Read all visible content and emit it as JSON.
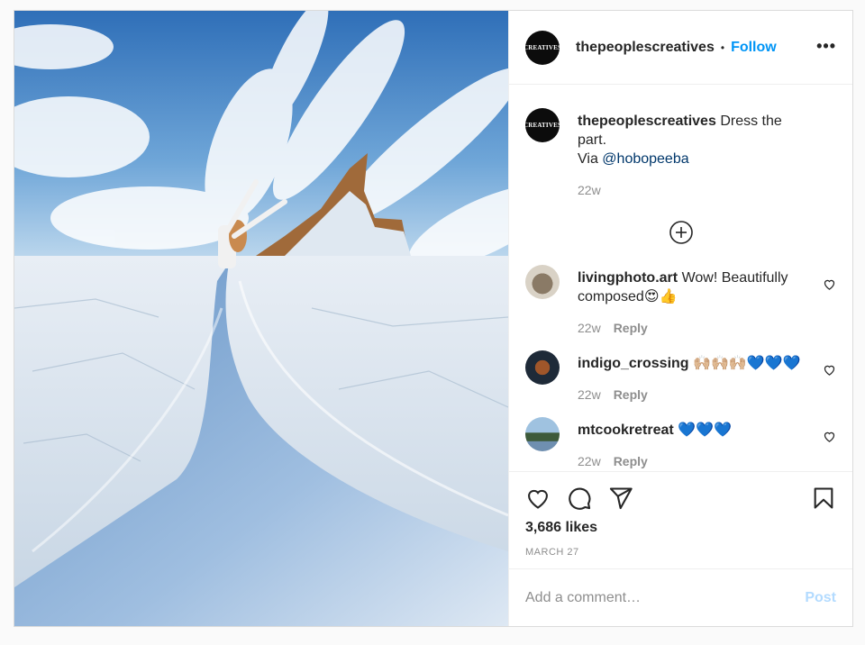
{
  "post": {
    "author": "thepeoplescreatives",
    "avatar_logo": "CREATIVES",
    "follow_label": "Follow",
    "more_label": "•••",
    "dot": "•"
  },
  "caption": {
    "username": "thepeoplescreatives",
    "text_before": "Dress the part.",
    "text_via": "Via",
    "mention": "@hobopeeba",
    "time": "22w"
  },
  "comments": [
    {
      "username": "livingphoto.art",
      "text": "Wow! Beautifully composed😍👍",
      "time": "22w",
      "reply_label": "Reply"
    },
    {
      "username": "indigo_crossing",
      "text": "🙌🏼🙌🏼🙌🏼💙💙💙",
      "time": "22w",
      "reply_label": "Reply"
    },
    {
      "username": "mtcookretreat",
      "text": "💙💙💙",
      "time": "22w",
      "reply_label": "Reply"
    }
  ],
  "stats": {
    "likes": "3,686 likes",
    "date": "MARCH 27"
  },
  "composer": {
    "placeholder": "Add a comment…",
    "post_label": "Post"
  },
  "colors": {
    "accent": "#0095f6",
    "post_disabled": "#b3dbff",
    "mention": "#00376b",
    "muted": "#8e8e8e"
  },
  "icons": [
    "heart-icon",
    "comment-icon",
    "share-icon",
    "bookmark-icon",
    "plus-circle-icon",
    "more-icon"
  ]
}
